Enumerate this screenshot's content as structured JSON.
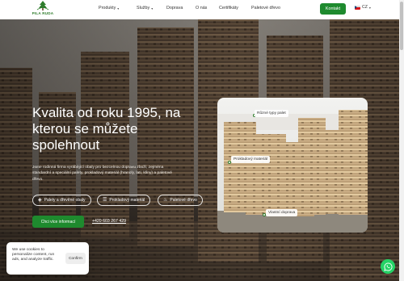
{
  "nav": {
    "logo_text": "PILA RUDA",
    "items": [
      {
        "label": "Produkty",
        "has_dropdown": true
      },
      {
        "label": "Služby",
        "has_dropdown": true
      },
      {
        "label": "Doprava",
        "has_dropdown": false
      },
      {
        "label": "O nás",
        "has_dropdown": false
      },
      {
        "label": "Certifikáty",
        "has_dropdown": false
      },
      {
        "label": "Paletové dřevo",
        "has_dropdown": false
      }
    ],
    "contact_label": "Kontakt",
    "lang_label": "CZ"
  },
  "hero": {
    "title": "Kvalita od roku 1995, na kterou se můžete spolehnout",
    "description": "Jsme rodinná firma vyrábějící obaly pro bezcelnou dopravu zboží, zejména standardní a speciální palety, prokladový materiál (hranoly, lati, klíny) a paletové dřevo.",
    "pills": [
      {
        "label": "Palety a dřevěné obaly",
        "icon": "box-icon"
      },
      {
        "label": "Prokladový materiál",
        "icon": "layers-icon"
      },
      {
        "label": "Paletové dřevo",
        "icon": "flame-icon"
      }
    ],
    "more_button": "Chci více informací",
    "phone": "+420 603 267 429"
  },
  "card": {
    "tags": [
      "Různé typy palet",
      "Prokladový materiál",
      "Vlastní doprava"
    ]
  },
  "cookie": {
    "text": "We use cookies to personalize content, run ads, and analyze traffic.",
    "confirm_label": "Confirm"
  },
  "colors": {
    "brand_green": "#1e8a2e",
    "whatsapp_green": "#25d366"
  }
}
